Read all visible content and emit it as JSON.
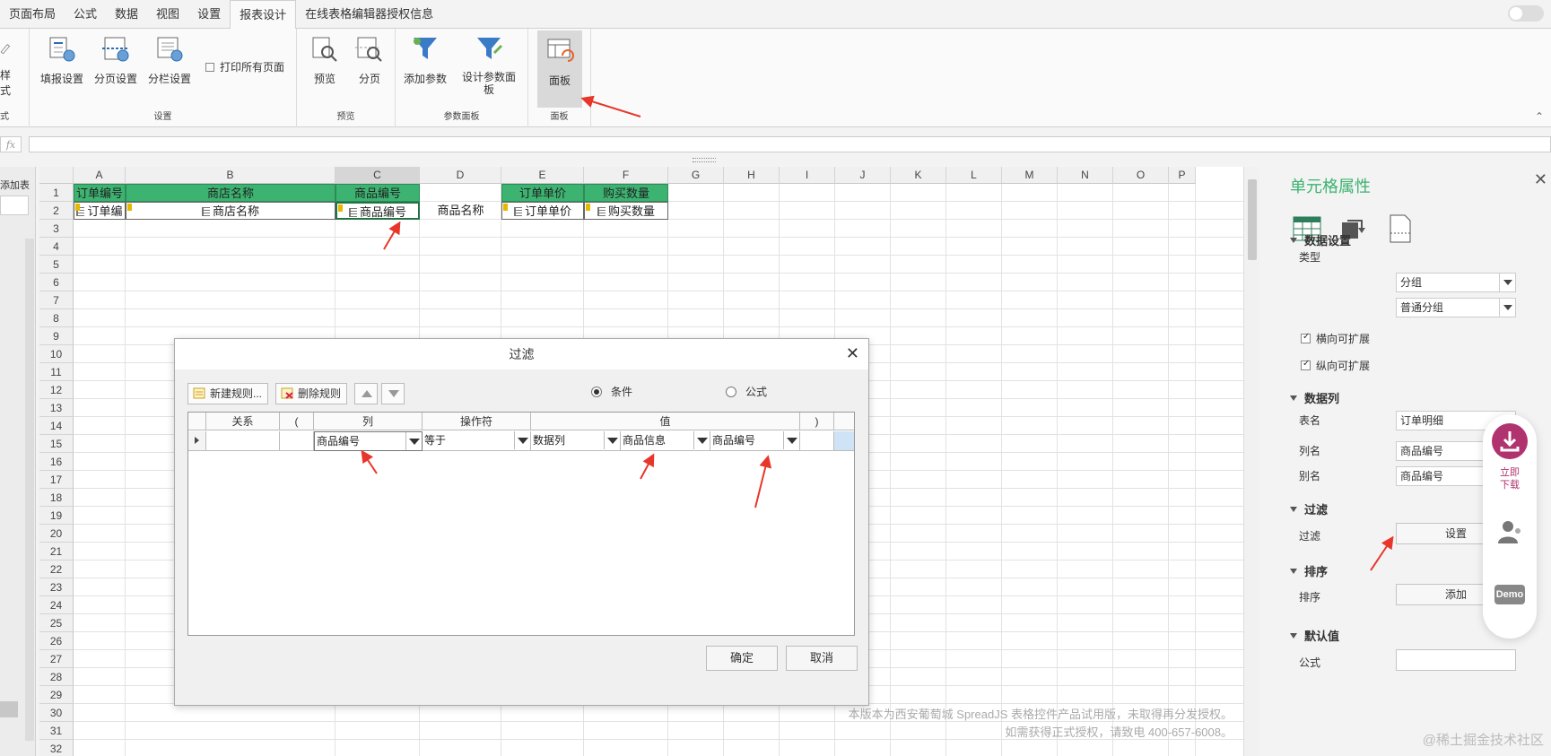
{
  "tabs": [
    "页面布局",
    "公式",
    "数据",
    "视图",
    "设置",
    "报表设计",
    "在线表格编辑器授权信息"
  ],
  "ribbon": {
    "partial": {
      "label": "样式",
      "group": "式"
    },
    "settings": {
      "buttons": [
        "填报设置",
        "分页设置",
        "分栏设置"
      ],
      "checkbox": "打印所有页面",
      "group": "设置"
    },
    "preview": {
      "buttons": [
        "预览",
        "分页"
      ],
      "group": "预览"
    },
    "params": {
      "buttons": [
        "添加参数",
        "设计参数面板"
      ],
      "group": "参数面板"
    },
    "panel": {
      "buttons": [
        "面板"
      ],
      "group": "面板"
    }
  },
  "formula_bar": {
    "fx": "fx",
    "value": ""
  },
  "left_panel": {
    "label": "添加表"
  },
  "columns": [
    "A",
    "B",
    "C",
    "D",
    "E",
    "F",
    "G",
    "H",
    "I",
    "J",
    "K",
    "L",
    "M",
    "N",
    "O",
    "P"
  ],
  "rows": [
    "1",
    "2",
    "3",
    "4",
    "5",
    "6",
    "7",
    "8",
    "9",
    "10",
    "11",
    "12",
    "13",
    "14",
    "15",
    "16",
    "17",
    "18",
    "19",
    "20",
    "21",
    "22",
    "23",
    "24",
    "25",
    "26",
    "27",
    "28",
    "29",
    "30",
    "31",
    "32"
  ],
  "cells": {
    "header_row": [
      "订单编号",
      "商店名称",
      "商品编号",
      "订单单价",
      "购买数量"
    ],
    "bind_row": [
      "订单编",
      "商店名称",
      "商品编号",
      "商品名称",
      "订单单价",
      "购买数量"
    ]
  },
  "watermark": {
    "line1": "本版本为西安葡萄城 SpreadJS 表格控件产品试用版，未取得再分发授权。",
    "line2": "如需获得正式授权，请致电 400-657-6008。"
  },
  "props": {
    "title": "单元格属性",
    "data_settings": {
      "title": "数据设置",
      "type_label": "类型",
      "type_value": "分组",
      "subtype_value": "普通分组",
      "check_h": "横向可扩展",
      "check_v": "纵向可扩展"
    },
    "data_column": {
      "title": "数据列",
      "table_label": "表名",
      "table_value": "订单明细",
      "col_label": "列名",
      "col_value": "商品编号",
      "alias_label": "别名",
      "alias_value": "商品编号"
    },
    "filter": {
      "title": "过滤",
      "label": "过滤",
      "button": "设置"
    },
    "sort": {
      "title": "排序",
      "label": "排序",
      "button": "添加"
    },
    "default": {
      "title": "默认值",
      "label": "公式"
    }
  },
  "float": {
    "download": "立即下载",
    "demo": "Demo"
  },
  "credit": "@稀土掘金技术社区",
  "dialog": {
    "title": "过滤",
    "new_rule": "新建规则...",
    "delete_rule": "删除规则",
    "radio_condition": "条件",
    "radio_formula": "公式",
    "headers": [
      "关系",
      "(",
      "列",
      "操作符",
      "值",
      ")"
    ],
    "row": {
      "relation": "",
      "lparen": "",
      "column": "商品编号",
      "operator": "等于",
      "value_type": "数据列",
      "value_table": "商品信息",
      "value_col": "商品编号",
      "rparen": ""
    },
    "ok": "确定",
    "cancel": "取消"
  },
  "colors": {
    "accent": "#3cb371",
    "header_fill": "#3cb371",
    "arrow": "#e8362b",
    "download": "#b0326e"
  }
}
